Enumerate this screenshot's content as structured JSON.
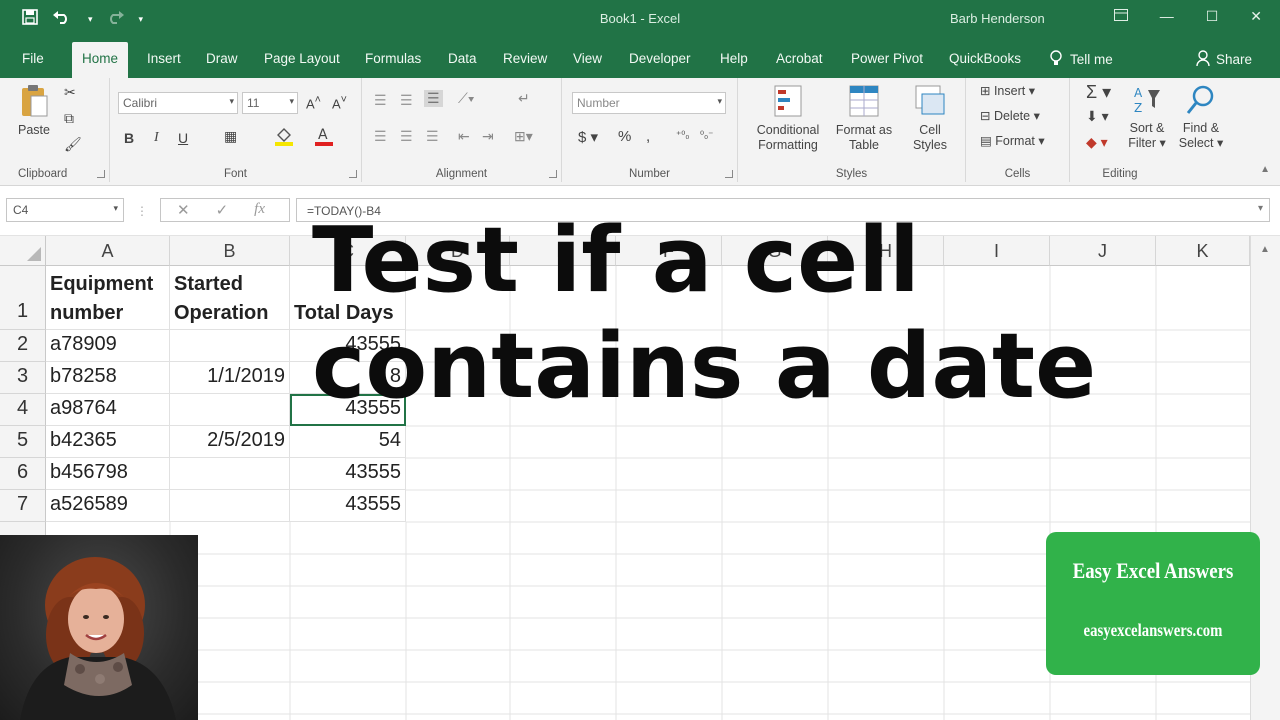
{
  "window": {
    "title": "Book1 - Excel",
    "user": "Barb Henderson"
  },
  "tabs": [
    "File",
    "Home",
    "Insert",
    "Draw",
    "Page Layout",
    "Formulas",
    "Data",
    "Review",
    "View",
    "Developer",
    "Help",
    "Acrobat",
    "Power Pivot",
    "QuickBooks"
  ],
  "active_tab": "Home",
  "tell_me": "Tell me",
  "share": "Share",
  "ribbon": {
    "clipboard": {
      "label": "Clipboard",
      "paste": "Paste"
    },
    "font": {
      "label": "Font",
      "font_name": "Calibri",
      "font_size": "11",
      "bold": "B",
      "italic": "I",
      "underline": "U"
    },
    "alignment": {
      "label": "Alignment"
    },
    "number": {
      "label": "Number",
      "format": "Number"
    },
    "styles": {
      "label": "Styles",
      "conditional": "Conditional",
      "conditional2": "Formatting",
      "format_as": "Format as",
      "format_as2": "Table",
      "cell_styles": "Cell",
      "cell_styles2": "Styles"
    },
    "cells": {
      "label": "Cells",
      "insert": "Insert",
      "delete": "Delete",
      "format": "Format"
    },
    "editing": {
      "label": "Editing",
      "sort": "Sort &",
      "sort2": "Filter",
      "find": "Find &",
      "find2": "Select"
    }
  },
  "formula_bar": {
    "name_box": "C4",
    "formula": "=TODAY()-B4"
  },
  "columns": [
    "A",
    "B",
    "C",
    "D",
    "E",
    "F",
    "G",
    "H",
    "I",
    "J",
    "K"
  ],
  "rows": [
    {
      "num": "1",
      "a": [
        "Equipment",
        "number"
      ],
      "b": [
        "Started",
        "Operation"
      ],
      "c": "Total Days"
    },
    {
      "num": "2",
      "a": "a78909",
      "b": "",
      "c": "43555"
    },
    {
      "num": "3",
      "a": "b78258",
      "b": "1/1/2019",
      "c": "8"
    },
    {
      "num": "4",
      "a": "a98764",
      "b": "",
      "c": "43555"
    },
    {
      "num": "5",
      "a": "b42365",
      "b": "2/5/2019",
      "c": "54"
    },
    {
      "num": "6",
      "a": "b456798",
      "b": "",
      "c": "43555"
    },
    {
      "num": "7",
      "a": "a526589",
      "b": "",
      "c": "43555"
    }
  ],
  "overlay": {
    "line1": "Test if a cell",
    "line2": "contains a date"
  },
  "badge": {
    "title": "Easy Excel Answers",
    "url": "easyexcelanswers.com"
  }
}
